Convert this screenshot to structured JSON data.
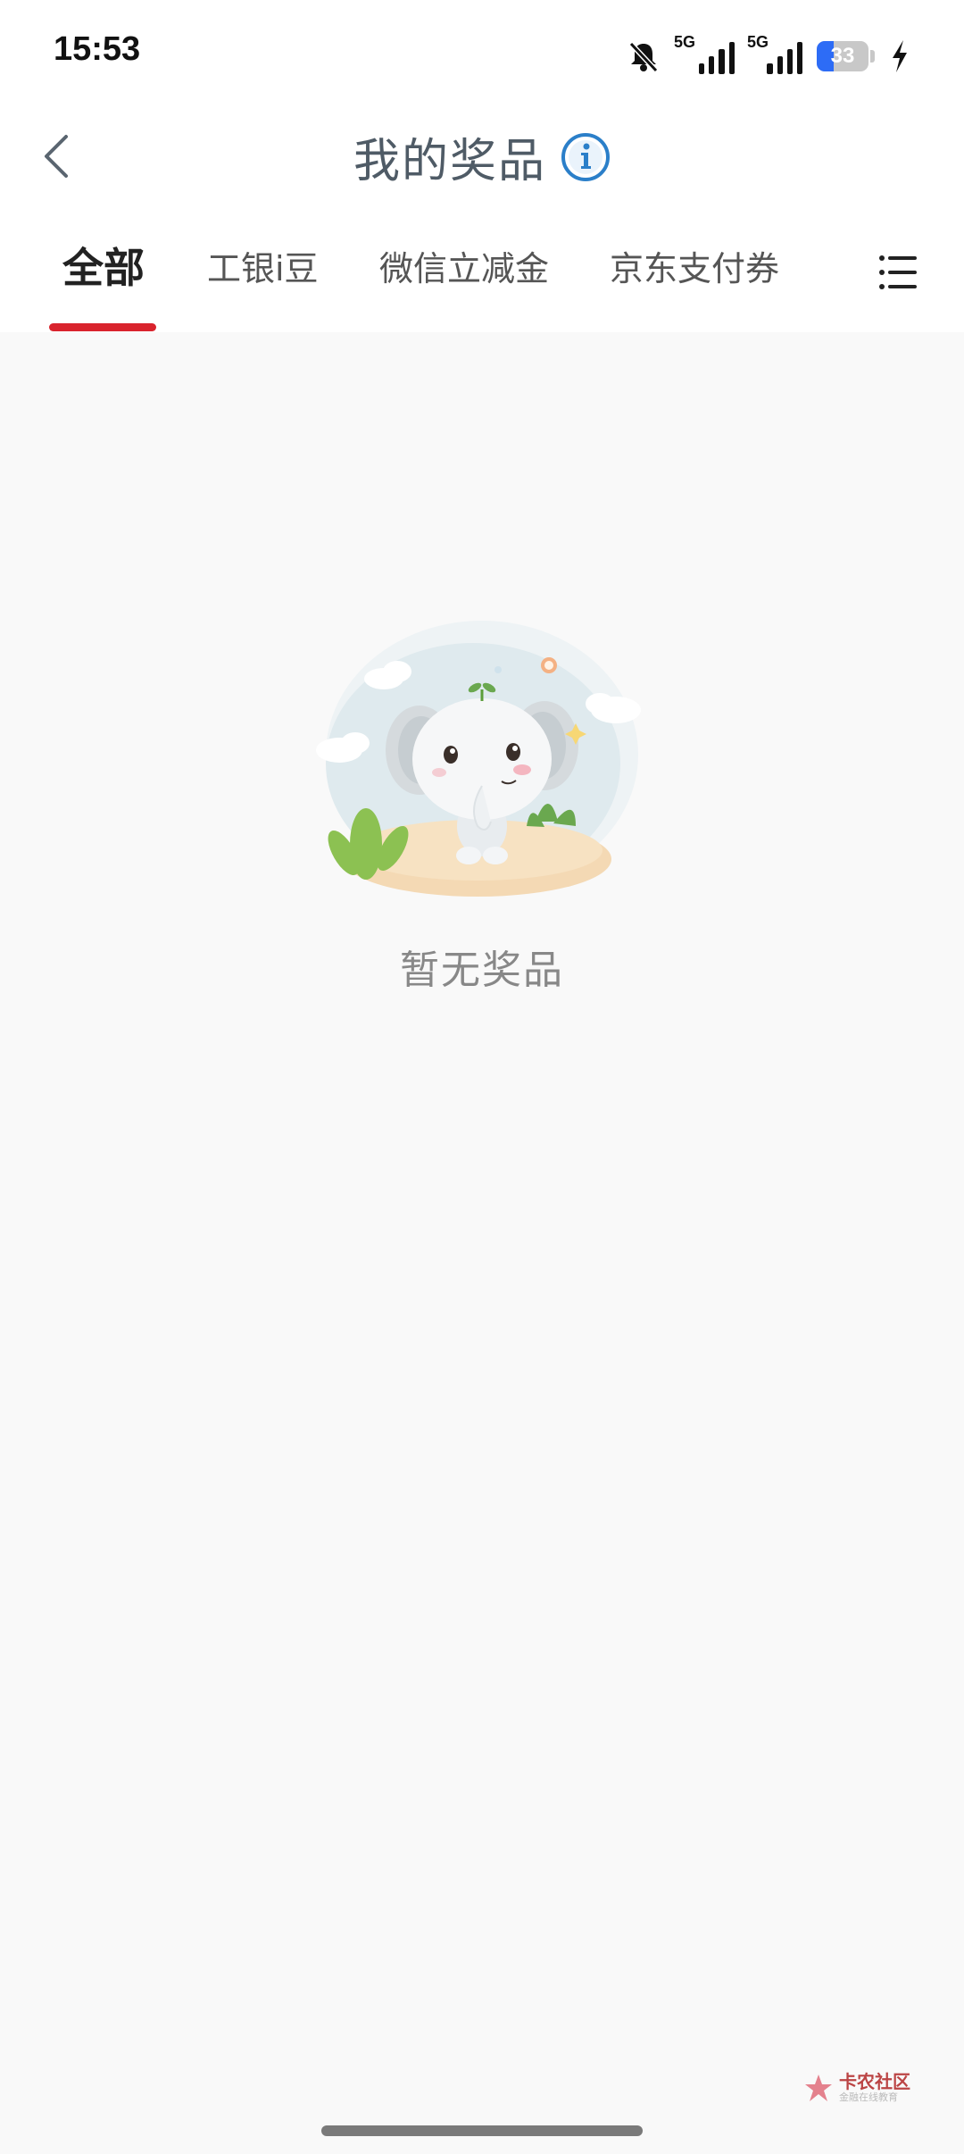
{
  "status_bar": {
    "time": "15:53",
    "signal1_label": "5G",
    "signal2_label": "5G",
    "battery_level": 33,
    "battery_text": "33"
  },
  "header": {
    "title": "我的奖品"
  },
  "tabs": [
    {
      "label": "全部",
      "active": true
    },
    {
      "label": "工银i豆",
      "active": false
    },
    {
      "label": "微信立减金",
      "active": false
    },
    {
      "label": "京东支付券",
      "active": false
    }
  ],
  "empty_state": {
    "message": "暂无奖品"
  },
  "watermark": {
    "main": "卡农社区",
    "sub": "金融在线教育"
  },
  "colors": {
    "accent_red": "#d9232d",
    "battery_blue": "#2d6cf6",
    "background": "#f9f9f9"
  }
}
